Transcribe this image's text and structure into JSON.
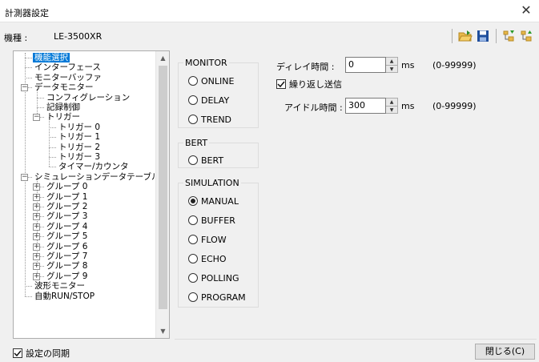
{
  "window": {
    "title": "計測器設定",
    "close_glyph": "✕"
  },
  "model": {
    "label": "機種 :",
    "value": "LE-3500XR"
  },
  "toolbar": {
    "icons": [
      "open-folder-icon",
      "save-icon",
      "tree-green-icon",
      "tree-yellow-icon"
    ]
  },
  "tree": {
    "nodes": [
      {
        "text": "機能選択",
        "level": 0,
        "selected": true
      },
      {
        "text": "インターフェース",
        "level": 0
      },
      {
        "text": "モニターバッファ",
        "level": 0
      },
      {
        "text": "データモニター",
        "level": 0,
        "toggle": "−"
      },
      {
        "text": "コンフィグレーション",
        "level": 1
      },
      {
        "text": "記録制御",
        "level": 1
      },
      {
        "text": "トリガー",
        "level": 1,
        "toggle": "−"
      },
      {
        "text": "トリガー 0",
        "level": 2
      },
      {
        "text": "トリガー 1",
        "level": 2
      },
      {
        "text": "トリガー 2",
        "level": 2
      },
      {
        "text": "トリガー 3",
        "level": 2
      },
      {
        "text": "タイマー/カウンタ",
        "level": 2
      },
      {
        "text": "シミュレーションデータテーブル",
        "level": 0,
        "toggle": "−"
      },
      {
        "text": "グループ 0",
        "level": 1,
        "toggle": "+"
      },
      {
        "text": "グループ 1",
        "level": 1,
        "toggle": "+"
      },
      {
        "text": "グループ 2",
        "level": 1,
        "toggle": "+"
      },
      {
        "text": "グループ 3",
        "level": 1,
        "toggle": "+"
      },
      {
        "text": "グループ 4",
        "level": 1,
        "toggle": "+"
      },
      {
        "text": "グループ 5",
        "level": 1,
        "toggle": "+"
      },
      {
        "text": "グループ 6",
        "level": 1,
        "toggle": "+"
      },
      {
        "text": "グループ 7",
        "level": 1,
        "toggle": "+"
      },
      {
        "text": "グループ 8",
        "level": 1,
        "toggle": "+"
      },
      {
        "text": "グループ 9",
        "level": 1,
        "toggle": "+"
      },
      {
        "text": "波形モニター",
        "level": 0
      },
      {
        "text": "自動RUN/STOP",
        "level": 0
      }
    ],
    "scroll_up": "▲",
    "scroll_down": "▼"
  },
  "monitor": {
    "title": "MONITOR",
    "options": [
      "ONLINE",
      "DELAY",
      "TREND"
    ]
  },
  "bert": {
    "title": "BERT",
    "options": [
      "BERT"
    ]
  },
  "simulation": {
    "title": "SIMULATION",
    "options": [
      "MANUAL",
      "BUFFER",
      "FLOW",
      "ECHO",
      "POLLING",
      "PROGRAM"
    ],
    "selected": "MANUAL"
  },
  "delay": {
    "label": "ディレイ時間 :",
    "value": "0",
    "unit": "ms",
    "range": "(0-99999)"
  },
  "repeat": {
    "label": "繰り返し送信",
    "checked": true
  },
  "idle": {
    "label": "アイドル時間 :",
    "value": "300",
    "unit": "ms",
    "range": "(0-99999)"
  },
  "footer": {
    "sync_label": "設定の同期",
    "sync_checked": true,
    "close_label": "閉じる(C)"
  }
}
